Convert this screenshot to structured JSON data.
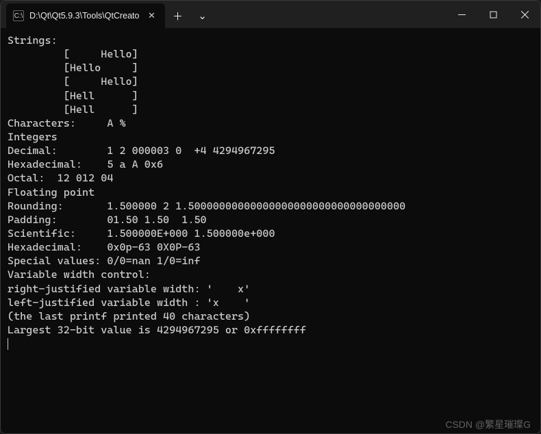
{
  "titlebar": {
    "tab_icon_text": "C:\\",
    "tab_title": "D:\\Qt\\Qt5.9.3\\Tools\\QtCreato",
    "close_glyph": "✕",
    "newtab_glyph": "＋",
    "dropdown_glyph": "⌄"
  },
  "terminal": {
    "lines": [
      "Strings:",
      "         [     Hello]",
      "         [Hello     ]",
      "         [     Hello]",
      "         [Hell      ]",
      "         [Hell      ]",
      "Characters:     A %",
      "Integers",
      "Decimal:        1 2 000003 0  +4 4294967295",
      "Hexadecimal:    5 a A 0x6",
      "Octal:  12 012 04",
      "Floating point",
      "Rounding:       1.500000 2 1.50000000000000000000000000000000000",
      "Padding:        01.50 1.50  1.50",
      "Scientific:     1.500000E+000 1.500000e+000",
      "Hexadecimal:    0x0p-63 0X0P-63",
      "Special values: 0/0=nan 1/0=inf",
      "Variable width control:",
      "right-justified variable width: '    x'",
      "left-justified variable width : 'x    '",
      "(the last printf printed 40 characters)",
      "Largest 32-bit value is 4294967295 or 0xffffffff"
    ]
  },
  "watermark": "CSDN @繁星璀璨G"
}
